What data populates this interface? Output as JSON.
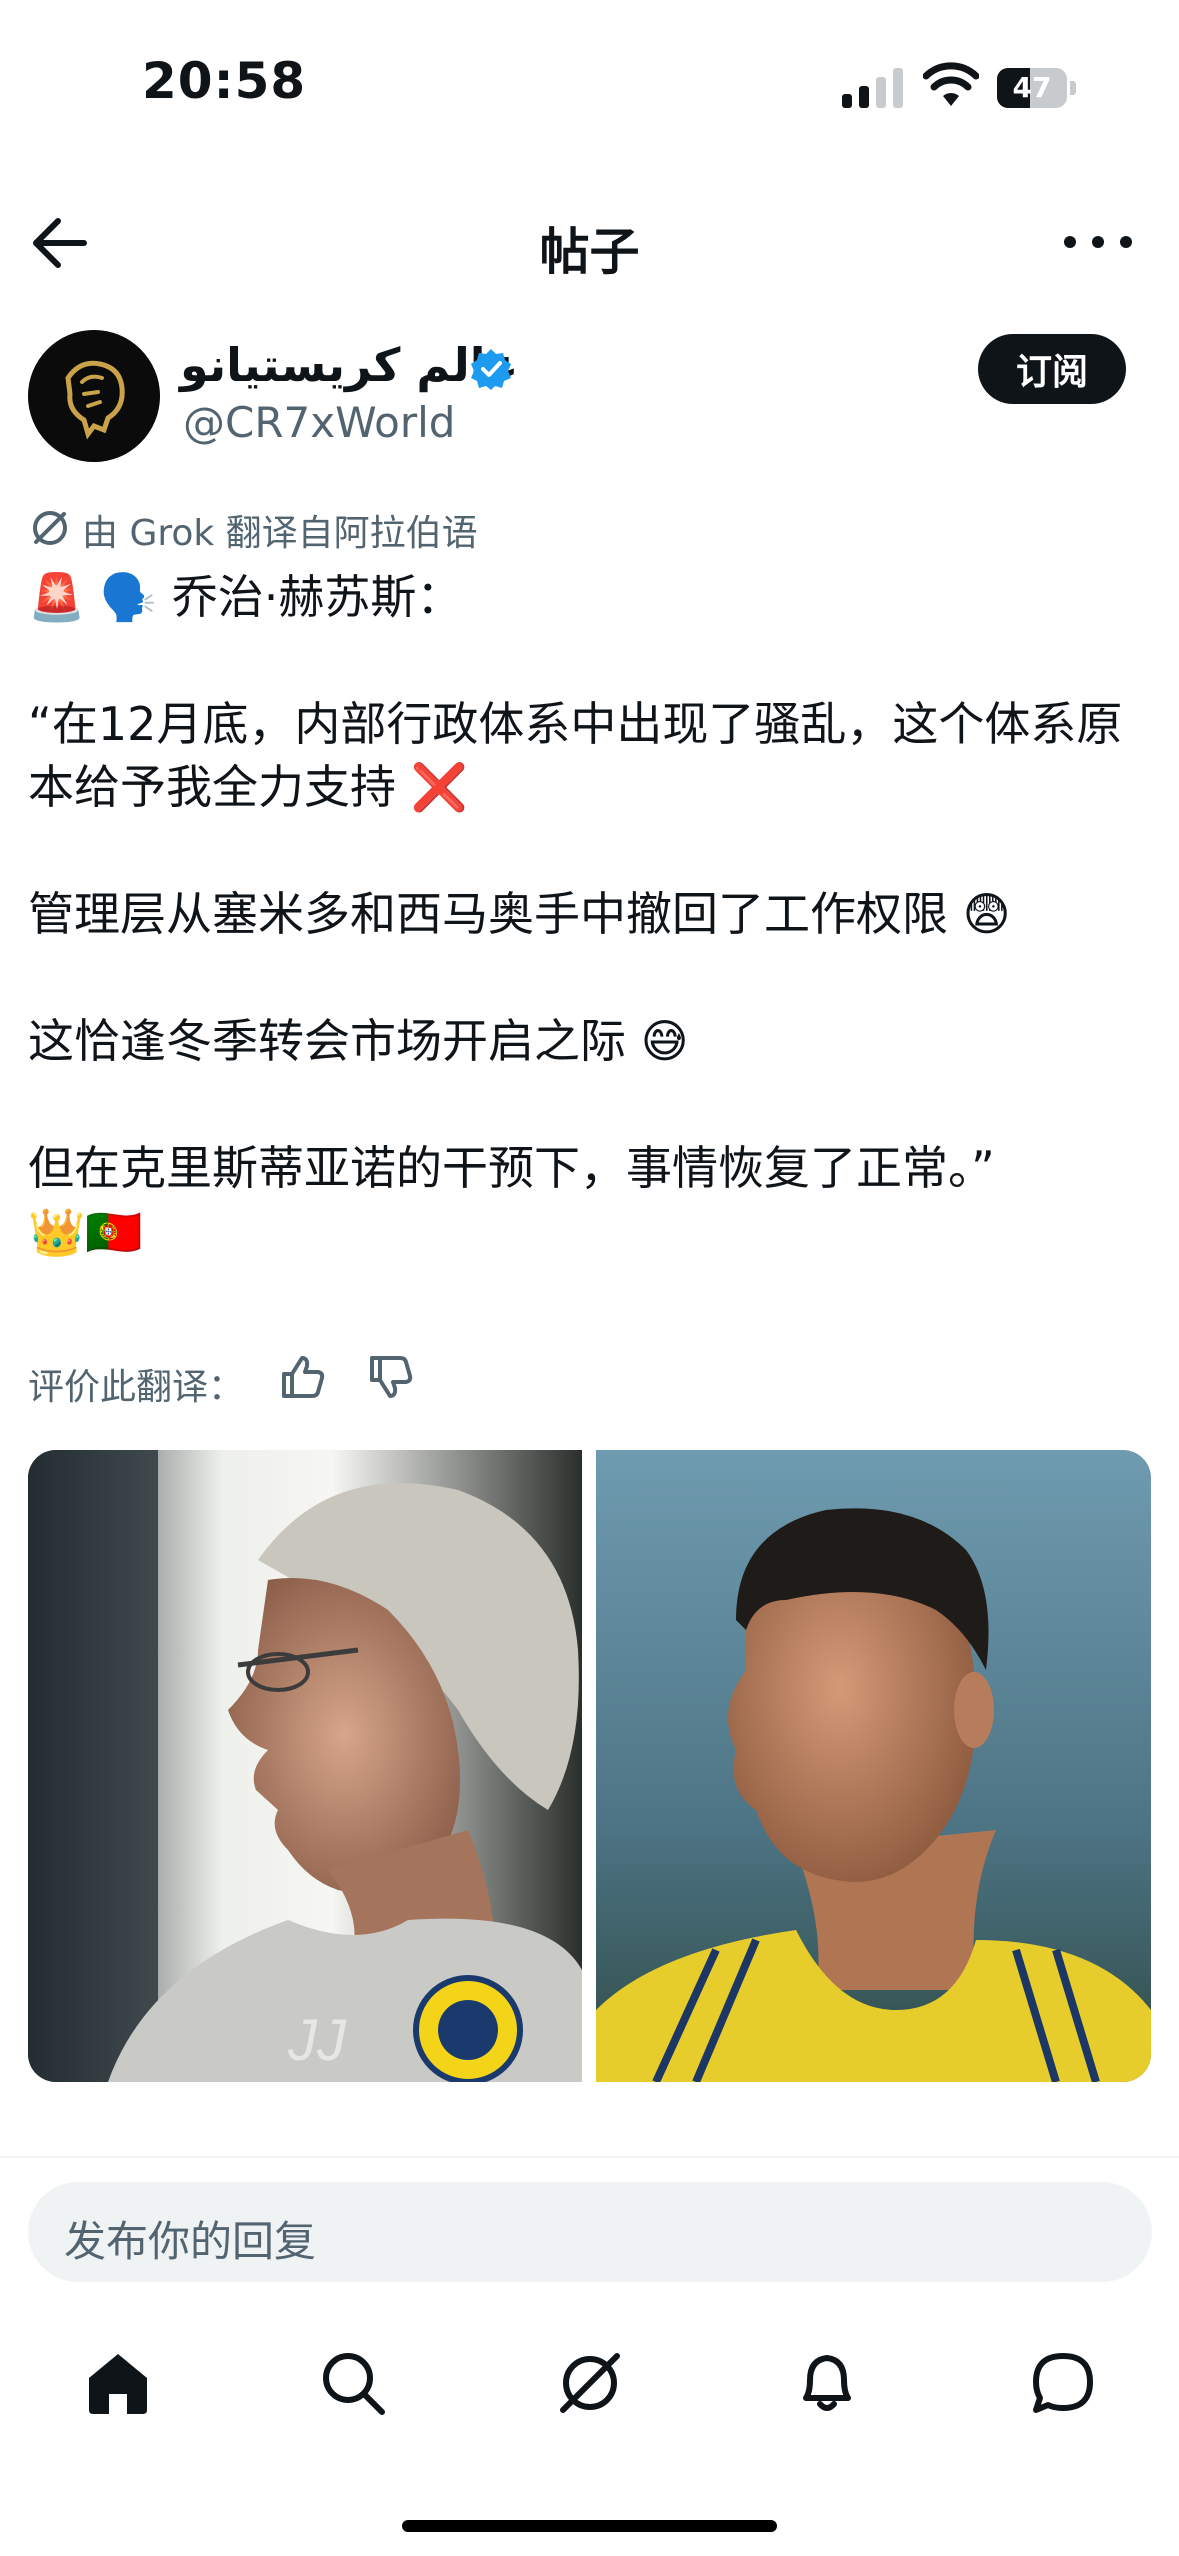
{
  "status_bar": {
    "time": "20:58",
    "battery": "47"
  },
  "nav": {
    "title": "帖子"
  },
  "author": {
    "display_name": "عالم كريستيانو",
    "handle": "@CR7xWorld",
    "subscribe_label": "订阅",
    "verified_color": "#1d9bf0"
  },
  "translation_note": "由 Grok 翻译自阿拉伯语",
  "tweet": {
    "text": "🚨 🗣️ 乔治·赫苏斯：\n\n“在12月底，内部行政体系中出现了骚乱，这个体系原本给予我全力支持 ❌\n\n管理层从塞米多和西马奥手中撤回了工作权限 😨\n\n这恰逢冬季转会市场开启之际 😅\n\n但在克里斯蒂亚诺的干预下，事情恢复了正常。”\n👑🇵🇹"
  },
  "rate_translation": {
    "label": "评价此翻译："
  },
  "media": {
    "left": {
      "shirt_text": "JJ"
    },
    "right": {}
  },
  "reply": {
    "placeholder": "发布你的回复"
  },
  "tabs": [
    "home-icon",
    "search-icon",
    "grok-icon",
    "notifications-icon",
    "messages-icon"
  ]
}
